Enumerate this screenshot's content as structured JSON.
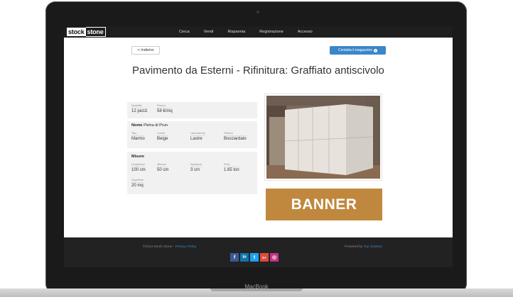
{
  "device": {
    "label": "MacBook"
  },
  "navbar": {
    "logo_part1": "stock",
    "logo_part2": "stone",
    "links": [
      "Cerca",
      "Vendi",
      "Risparmia",
      "Registrazione",
      "Accesso"
    ]
  },
  "page": {
    "back_label": "< Indietro",
    "contact_label": "Contatta il magazzino",
    "title": "Pavimento da Esterni - Rifinitura: Graffiato antiscivolo"
  },
  "panel1": {
    "fields": [
      {
        "label": "Quantità",
        "value": "12 pezzi"
      },
      {
        "label": "Prezzo",
        "value": "58 €/mq"
      }
    ]
  },
  "panel2": {
    "name_label": "Nome",
    "name_value": "Pietra di Prun",
    "fields": [
      {
        "label": "Tipo",
        "value": "Marmo"
      },
      {
        "label": "Colore",
        "value": "Beige"
      },
      {
        "label": "Lavorazione",
        "value": "Lastre"
      },
      {
        "label": "Finitura",
        "value": "Bocciardato"
      }
    ]
  },
  "panel3": {
    "title": "Misure",
    "fields": [
      {
        "label": "Lunghezza",
        "value": "100 cm"
      },
      {
        "label": "Altezza",
        "value": "50 cm"
      },
      {
        "label": "Spessore",
        "value": "3 cm"
      },
      {
        "label": "Peso",
        "value": "1.65 ton"
      },
      {
        "label": "Superficie",
        "value": "20 mq"
      }
    ]
  },
  "banner": {
    "text": "BANNER"
  },
  "footer": {
    "copyright": "©2014 Stock Stone - ",
    "privacy": "Privacy Policy",
    "powered": "Powered by ",
    "powered_link": "Top Solution",
    "socials": [
      {
        "name": "facebook",
        "glyph": "f"
      },
      {
        "name": "linkedin",
        "glyph": "in"
      },
      {
        "name": "twitter",
        "glyph": "t"
      },
      {
        "name": "google-plus",
        "glyph": "G+"
      },
      {
        "name": "instagram",
        "glyph": "◎"
      }
    ]
  }
}
